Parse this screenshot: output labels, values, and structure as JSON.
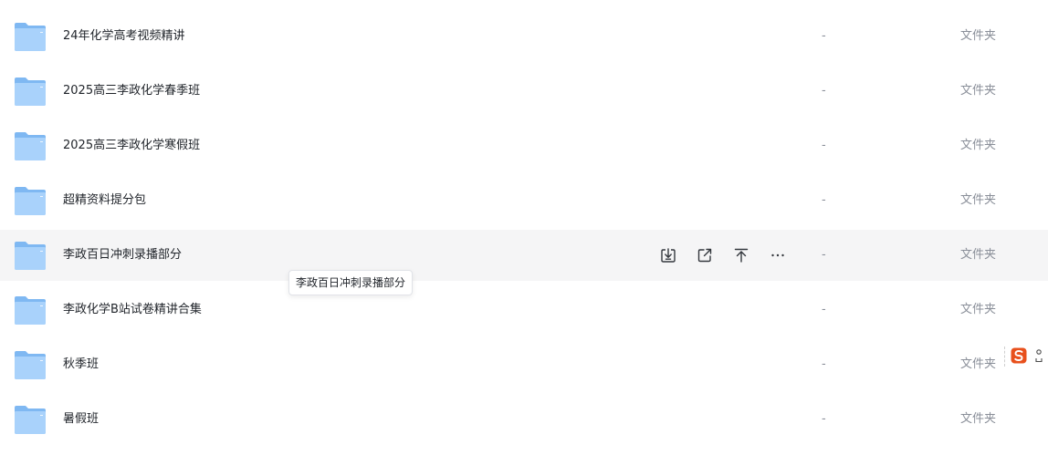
{
  "file_list": {
    "rows": [
      {
        "name": "24年化学高考视频精讲",
        "size": "-",
        "type": "文件夹"
      },
      {
        "name": "2025高三李政化学春季班",
        "size": "-",
        "type": "文件夹"
      },
      {
        "name": "2025高三李政化学寒假班",
        "size": "-",
        "type": "文件夹"
      },
      {
        "name": "超精资料提分包",
        "size": "-",
        "type": "文件夹"
      },
      {
        "name": "李政百日冲刺录播部分",
        "size": "-",
        "type": "文件夹",
        "hovered": true
      },
      {
        "name": "李政化学B站试卷精讲合集",
        "size": "-",
        "type": "文件夹"
      },
      {
        "name": "秋季班",
        "size": "-",
        "type": "文件夹"
      },
      {
        "name": "暑假班",
        "size": "-",
        "type": "文件夹"
      }
    ]
  },
  "row_actions": {
    "icons": [
      "download-icon",
      "share-icon",
      "pin-to-top-icon",
      "more-icon"
    ]
  },
  "tooltip": {
    "text": "李政百日冲刺录播部分"
  },
  "colors": {
    "folder_light": "#a9d2fb",
    "folder_dark": "#7fb8f2",
    "hover_bg": "#f5f5f6",
    "muted_text": "#8a8f99",
    "ime_accent": "#e8501c"
  }
}
